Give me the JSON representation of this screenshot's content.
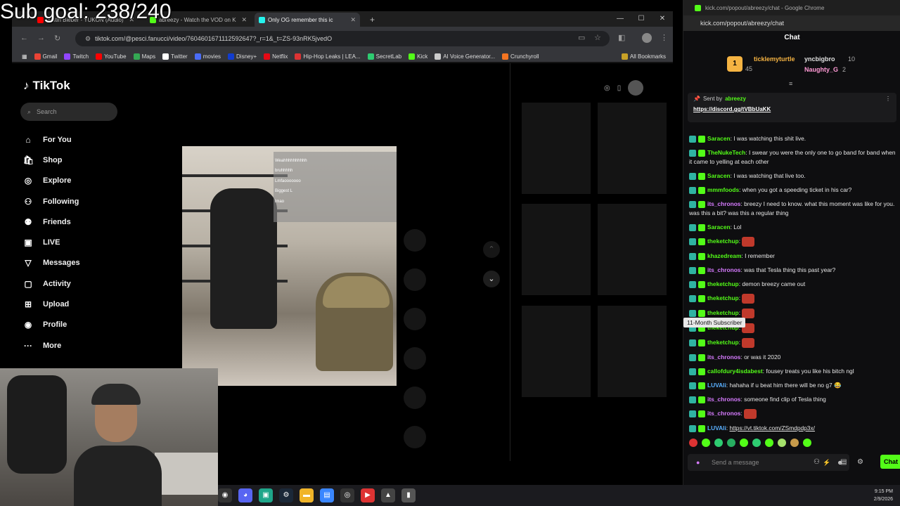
{
  "overlay": {
    "sub_goal": "Sub goal: 238/240"
  },
  "browser": {
    "tabs": [
      {
        "label": "Justin Bieber - YUKON (Audio)",
        "color": "#ff0000"
      },
      {
        "label": "abreezy - Watch the VOD on K",
        "color": "#53fc18"
      },
      {
        "label": "Only OG remember this ic",
        "color": "#25f4ee",
        "active": true
      }
    ],
    "new_tab": "+",
    "url": "tiktok.com/@pesci.fanucci/video/7604601671112592647?_r=1&_t=ZS-93nRK5jvedO",
    "bookmarks": [
      "Gmail",
      "Twitch",
      "YouTube",
      "Maps",
      "Twitter",
      "movies",
      "Disney+",
      "Netflix",
      "Hip-Hop Leaks | LEA...",
      "SecretLab",
      "Kick",
      "AI Voice Generator...",
      "Crunchyroll"
    ],
    "all_bookmarks": "All Bookmarks"
  },
  "tiktok": {
    "logo": "TikTok",
    "search_placeholder": "Search",
    "nav": [
      {
        "label": "For You",
        "icon": "home-icon"
      },
      {
        "label": "Shop",
        "icon": "shop-icon"
      },
      {
        "label": "Explore",
        "icon": "compass-icon"
      },
      {
        "label": "Following",
        "icon": "person-icon"
      },
      {
        "label": "Friends",
        "icon": "friends-icon"
      },
      {
        "label": "LIVE",
        "icon": "live-icon"
      },
      {
        "label": "Messages",
        "icon": "messages-icon"
      },
      {
        "label": "Activity",
        "icon": "activity-icon"
      },
      {
        "label": "Upload",
        "icon": "upload-icon"
      },
      {
        "label": "Profile",
        "icon": "avatar-icon"
      },
      {
        "label": "More",
        "icon": "more-icon"
      }
    ],
    "video_overlay_lines": [
      "Weahhhhhhhhhh",
      "bruhhhhh",
      "Lmfaooooooo",
      "Biggest L",
      "lmao"
    ]
  },
  "chat_window": {
    "title": "kick.com/popout/abreezy/chat - Google Chrome",
    "url": "kick.com/popout/abreezy/chat",
    "header": "Chat",
    "leaderboard": [
      {
        "name": "ticklemyturtle",
        "count": "45",
        "color": "#f5b342"
      },
      {
        "name": "yncbigbro",
        "count": "10",
        "color": "#e0e0e0"
      },
      {
        "name": "Naughty_G",
        "count": "2",
        "color": "#ff9ad5"
      }
    ],
    "pinned": {
      "sent_by_label": "Sent by",
      "user": "abreezy",
      "link": "https://discord.gg/tVBbUaKK"
    },
    "messages": [
      {
        "user": "Saracen",
        "color": "#53fc18",
        "text": "I was watching this shit live."
      },
      {
        "user": "TheNukeTech",
        "color": "#53fc18",
        "text": "I swear you were the only one to go band for band when it came to yelling at each other"
      },
      {
        "user": "Saracen",
        "color": "#53fc18",
        "text": "I was watching that live too."
      },
      {
        "user": "mmmfoods",
        "color": "#53fc18",
        "text": "when you got a speeding ticket in his car?"
      },
      {
        "user": "its_chronos",
        "color": "#d77bff",
        "text": "breezy I need to know. what this moment was like for you. was this a bit? was this a regular thing"
      },
      {
        "user": "Saracen",
        "color": "#53fc18",
        "text": "Lol"
      },
      {
        "user": "theketchup",
        "color": "#53fc18",
        "text": ""
      },
      {
        "user": "khazedream",
        "color": "#53fc18",
        "text": "I remember"
      },
      {
        "user": "its_chronos",
        "color": "#d77bff",
        "text": "was that Tesla thing this past year?"
      },
      {
        "user": "theketchup",
        "color": "#53fc18",
        "text": "demon breezy came out"
      },
      {
        "user": "theketchup",
        "color": "#53fc18",
        "text": ""
      },
      {
        "user": "theketchup",
        "color": "#53fc18",
        "text": ""
      },
      {
        "user": "theketchup",
        "color": "#53fc18",
        "text": ""
      },
      {
        "user": "theketchup",
        "color": "#53fc18",
        "text": ""
      },
      {
        "user": "its_chronos",
        "color": "#d77bff",
        "text": "or was it 2020"
      },
      {
        "user": "callofdury4isdabest",
        "color": "#53fc18",
        "text": "fousey treats you like his bitch ngl"
      },
      {
        "user": "LUVAli",
        "color": "#5ab0ff",
        "text": "hahaha if u beat him there will be no g7 😂"
      },
      {
        "user": "its_chronos",
        "color": "#d77bff",
        "text": "someone find clip of Tesla thing"
      },
      {
        "user": "its_chronos",
        "color": "#d77bff",
        "text": ""
      },
      {
        "user": "LUVAli",
        "color": "#5ab0ff",
        "text": "https://vt.tiktok.com/ZSmdpdp3x/"
      }
    ],
    "tooltip": "11-Month Subscriber",
    "composer_placeholder": "Send a message",
    "send_label": "Chat"
  },
  "taskbar": {
    "time": "9:15 PM",
    "date": "2/9/2026"
  },
  "colors": {
    "kick_green": "#53fc18",
    "tiktok_bg": "#000000",
    "chrome_bar": "#35363a"
  }
}
